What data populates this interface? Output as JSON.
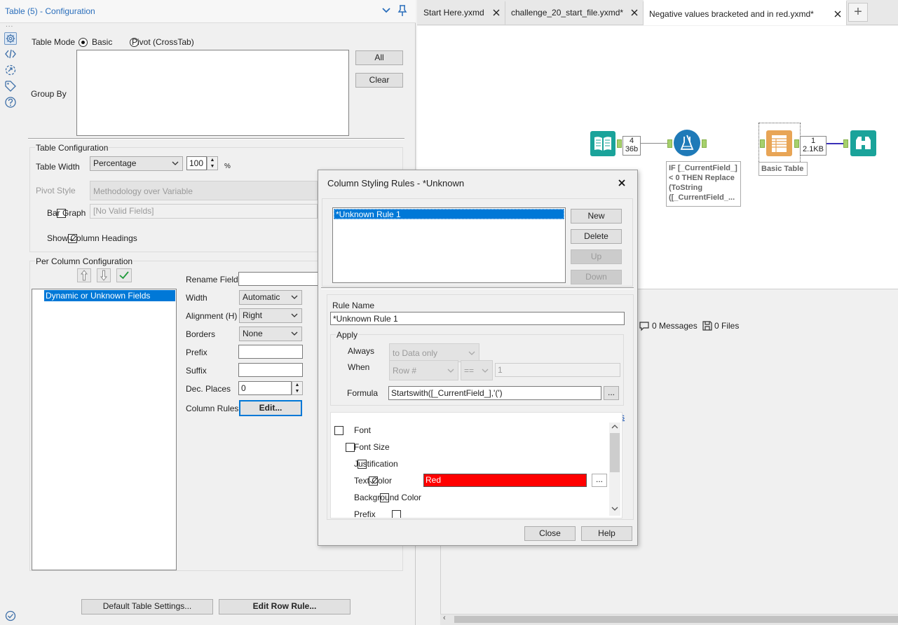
{
  "panel": {
    "title": "Table (5) - Configuration",
    "ellipsis": "...",
    "table_mode_label": "Table Mode",
    "mode_basic": "Basic",
    "mode_pivot": "Pivot (CrossTab)",
    "mode_selected": "Basic",
    "group_by_label": "Group By",
    "all_button": "All",
    "clear_button": "Clear",
    "table_config_title": "Table Configuration",
    "table_width_label": "Table Width",
    "table_width_mode": "Percentage",
    "table_width_value": "100",
    "table_width_unit": "%",
    "pivot_style_label": "Pivot Style",
    "pivot_style_value": "Methodology over Variable",
    "bar_graph_label": "Bar Graph",
    "bar_graph_checked": false,
    "bar_graph_value": "[No Valid Fields]",
    "show_col_headings_label": "Show Column Headings",
    "show_col_headings_checked": true,
    "per_column_title": "Per Column Configuration",
    "fields": [
      {
        "label": "Dynamic or Unknown Fields",
        "checked": true,
        "selected": true
      }
    ],
    "rename_field_label": "Rename Field",
    "rename_field_value": "",
    "width_label": "Width",
    "width_value": "Automatic",
    "alignment_label": "Alignment (H)",
    "alignment_value": "Right",
    "borders_label": "Borders",
    "borders_value": "None",
    "prefix_label": "Prefix",
    "prefix_value": "",
    "suffix_label": "Suffix",
    "suffix_value": "",
    "dec_places_label": "Dec. Places",
    "dec_places_value": "0",
    "column_rules_label": "Column Rules",
    "edit_button": "Edit...",
    "default_settings_button": "Default Table Settings...",
    "edit_row_rule_button": "Edit Row Rule..."
  },
  "tabs": [
    {
      "label": "Start Here.yxmd",
      "active": false
    },
    {
      "label": "challenge_20_start_file.yxmd*",
      "active": false
    },
    {
      "label": "Negative values bracketed and in red.yxmd*",
      "active": true
    }
  ],
  "add_tab": "+",
  "workflow": {
    "conn1_top": "4",
    "conn1_bottom": "36b",
    "formula_annotation": [
      "IF [_CurrentField_]",
      "< 0 THEN Replace",
      "(ToString",
      "([_CurrentField_..."
    ],
    "table_annotation": "Basic Table",
    "conn2_top": "1",
    "conn2_bottom": "2.1KB",
    "colors": {
      "input": "#1aa39a",
      "formula": "#1f7ab8",
      "table": "#e8a556",
      "browse": "#1aa39a",
      "anchor": "#a6d06c"
    }
  },
  "results": {
    "messages": "0 Messages",
    "files": "0 Files"
  },
  "dialog": {
    "title": "Column Styling Rules - *Unknown",
    "rules": [
      "*Unknown Rule 1"
    ],
    "new_button": "New",
    "delete_button": "Delete",
    "up_button": "Up",
    "down_button": "Down",
    "rule_name_label": "Rule Name",
    "rule_name_value": "*Unknown Rule 1",
    "apply_label": "Apply",
    "always_label": "Always",
    "always_option": "to Data only",
    "when_label": "When",
    "when_field": "Row #",
    "when_operator": "==",
    "when_value": "1",
    "formula_label": "Formula",
    "formula_value": "Startswith([_CurrentField_],'(')",
    "formula_button": "...",
    "apply_selected": "Formula",
    "reset_link": "Reset to Defaults",
    "properties": [
      {
        "label": "Font",
        "checked": false
      },
      {
        "label": "Font Size",
        "checked": false
      },
      {
        "label": "Justification",
        "checked": false
      },
      {
        "label": "Text Color",
        "checked": true,
        "value": "Red",
        "color": "#ff0000"
      },
      {
        "label": "Background Color",
        "checked": false
      },
      {
        "label": "Prefix",
        "checked": false
      }
    ],
    "color_button": "...",
    "close_button": "Close",
    "help_button": "Help"
  }
}
